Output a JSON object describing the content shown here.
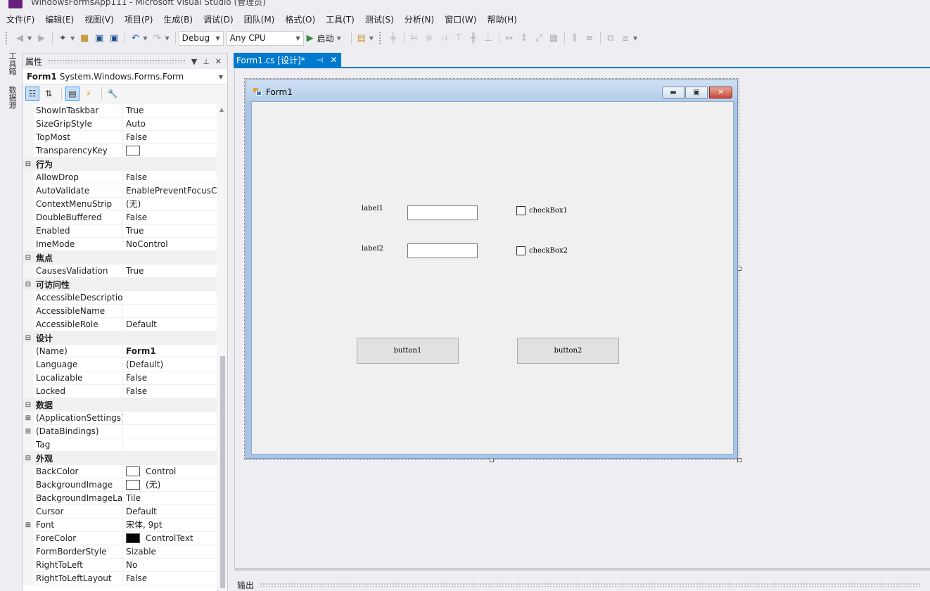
{
  "window": {
    "title": "WindowsFormsApp111 - Microsoft Visual Studio (管理员)"
  },
  "menu": [
    "文件(F)",
    "编辑(E)",
    "视图(V)",
    "项目(P)",
    "生成(B)",
    "调试(D)",
    "团队(M)",
    "格式(O)",
    "工具(T)",
    "测试(S)",
    "分析(N)",
    "窗口(W)",
    "帮助(H)"
  ],
  "toolbar": {
    "config": "Debug",
    "platform": "Any CPU",
    "start_label": "启动"
  },
  "side_tabs": {
    "toolbox": "工具箱",
    "datasources": "数据源"
  },
  "properties": {
    "title": "属性",
    "object_name": "Form1",
    "object_type": "System.Windows.Forms.Form",
    "rows": [
      {
        "kind": "prop",
        "name": "ShowInTaskbar",
        "value": "True"
      },
      {
        "kind": "prop",
        "name": "SizeGripStyle",
        "value": "Auto"
      },
      {
        "kind": "prop",
        "name": "TopMost",
        "value": "False"
      },
      {
        "kind": "prop",
        "name": "TransparencyKey",
        "value": "",
        "swatch": "white"
      },
      {
        "kind": "cat",
        "name": "行为"
      },
      {
        "kind": "prop",
        "name": "AllowDrop",
        "value": "False"
      },
      {
        "kind": "prop",
        "name": "AutoValidate",
        "value": "EnablePreventFocusChange"
      },
      {
        "kind": "prop",
        "name": "ContextMenuStrip",
        "value": "(无)"
      },
      {
        "kind": "prop",
        "name": "DoubleBuffered",
        "value": "False"
      },
      {
        "kind": "prop",
        "name": "Enabled",
        "value": "True"
      },
      {
        "kind": "prop",
        "name": "ImeMode",
        "value": "NoControl"
      },
      {
        "kind": "cat",
        "name": "焦点"
      },
      {
        "kind": "prop",
        "name": "CausesValidation",
        "value": "True"
      },
      {
        "kind": "cat",
        "name": "可访问性"
      },
      {
        "kind": "prop",
        "name": "AccessibleDescription",
        "value": ""
      },
      {
        "kind": "prop",
        "name": "AccessibleName",
        "value": ""
      },
      {
        "kind": "prop",
        "name": "AccessibleRole",
        "value": "Default"
      },
      {
        "kind": "cat",
        "name": "设计"
      },
      {
        "kind": "prop",
        "name": "(Name)",
        "value": "Form1",
        "bold": true
      },
      {
        "kind": "prop",
        "name": "Language",
        "value": "(Default)"
      },
      {
        "kind": "prop",
        "name": "Localizable",
        "value": "False"
      },
      {
        "kind": "prop",
        "name": "Locked",
        "value": "False"
      },
      {
        "kind": "cat",
        "name": "数据"
      },
      {
        "kind": "prop",
        "name": "(ApplicationSettings)",
        "value": "",
        "expand": true
      },
      {
        "kind": "prop",
        "name": "(DataBindings)",
        "value": "",
        "expand": true
      },
      {
        "kind": "prop",
        "name": "Tag",
        "value": ""
      },
      {
        "kind": "cat",
        "name": "外观"
      },
      {
        "kind": "prop",
        "name": "BackColor",
        "value": "Control",
        "swatch": "white"
      },
      {
        "kind": "prop",
        "name": "BackgroundImage",
        "value": "(无)",
        "swatch": "white"
      },
      {
        "kind": "prop",
        "name": "BackgroundImageLayout",
        "value": "Tile"
      },
      {
        "kind": "prop",
        "name": "Cursor",
        "value": "Default"
      },
      {
        "kind": "prop",
        "name": "Font",
        "value": "宋体, 9pt",
        "expand": true
      },
      {
        "kind": "prop",
        "name": "ForeColor",
        "value": "ControlText",
        "swatch": "black"
      },
      {
        "kind": "prop",
        "name": "FormBorderStyle",
        "value": "Sizable"
      },
      {
        "kind": "prop",
        "name": "RightToLeft",
        "value": "No"
      },
      {
        "kind": "prop",
        "name": "RightToLeftLayout",
        "value": "False"
      }
    ]
  },
  "document_tab": {
    "label": "Form1.cs [设计]*"
  },
  "form": {
    "caption": "Form1",
    "label1": "label1",
    "label2": "label2",
    "checkbox1": "checkBox1",
    "checkbox2": "checkBox2",
    "button1": "button1",
    "button2": "button2"
  },
  "output": {
    "title": "输出"
  },
  "colors": {
    "accent": "#007acc",
    "form_border": "#a9c6e8",
    "close_button": "#c8493a"
  }
}
